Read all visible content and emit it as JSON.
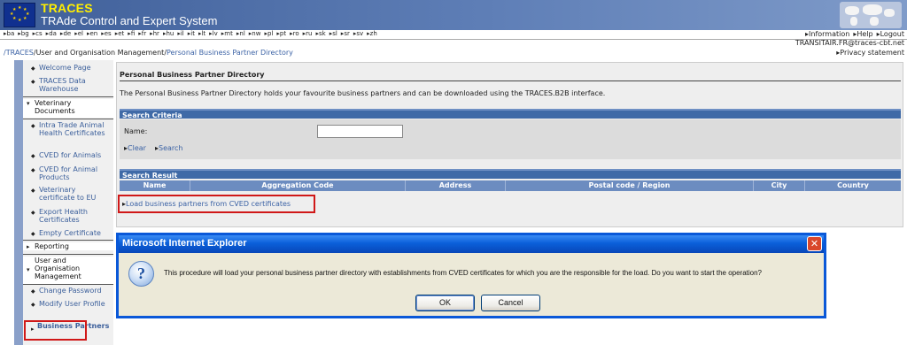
{
  "header": {
    "app_title": "TRACES",
    "app_subtitle": "TRAde Control and Expert System",
    "languages": [
      "ba",
      "bg",
      "cs",
      "da",
      "de",
      "el",
      "en",
      "es",
      "et",
      "fi",
      "fr",
      "hr",
      "hu",
      "il",
      "it",
      "lt",
      "lv",
      "mt",
      "nl",
      "nw",
      "pl",
      "pt",
      "ro",
      "ru",
      "sk",
      "sl",
      "sr",
      "sv",
      "zh"
    ],
    "top_links": [
      "Information",
      "Help",
      "Logout"
    ],
    "user_email": "TRANSITAIR.FR@traces-cbt.net",
    "privacy_link": "Privacy statement"
  },
  "breadcrumb": {
    "root": "/TRACES",
    "sep": "/",
    "section": "User and Organisation Management",
    "current": "Personal Business Partner Directory"
  },
  "sidebar": {
    "welcome": "Welcome Page",
    "warehouse": "TRACES Data Warehouse",
    "vet_docs": "Veterinary Documents",
    "intra_trade": "Intra Trade Animal Health Certificates",
    "cved_animals": "CVED for Animals",
    "cved_products": "CVED for Animal Products",
    "vet_cert_eu": "Veterinary certificate to EU",
    "export_health": "Export Health Certificates",
    "empty_cert": "Empty Certificate",
    "reporting": "Reporting",
    "user_org": "User and Organisation Management",
    "change_password": "Change Password",
    "modify_profile": "Modify User Profile",
    "business_partners": "Business Partners"
  },
  "main": {
    "heading": "Personal Business Partner Directory",
    "intro": "The Personal Business Partner Directory holds your favourite business partners and can be downloaded using the TRACES.B2B interface.",
    "search_criteria_title": "Search Criteria",
    "name_label": "Name:",
    "name_value": "",
    "clear_label": "Clear",
    "search_label": "Search",
    "search_result_title": "Search Result",
    "columns": [
      "Name",
      "Aggregation Code",
      "Address",
      "Postal code / Region",
      "City",
      "Country"
    ],
    "load_link": "Load business partners from CVED certificates"
  },
  "dialog": {
    "title": "Microsoft Internet Explorer",
    "close_glyph": "✕",
    "icon_glyph": "?",
    "message": "This procedure will load your personal business partner directory with establishments from CVED certificates for which you are the responsible for the load. Do you want to start the operation?",
    "ok_label": "OK",
    "cancel_label": "Cancel"
  },
  "colors": {
    "banner_blue": "#3f5f99",
    "section_bar": "#3f6aa7",
    "highlight_red": "#d01818",
    "xp_title_blue": "#0a58d8"
  }
}
